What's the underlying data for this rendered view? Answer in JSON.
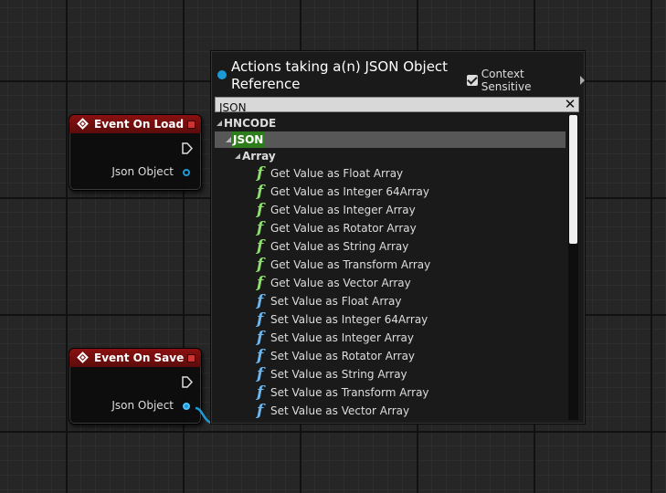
{
  "nodes": {
    "load": {
      "title": "Event On Load",
      "pin_label": "Json Object"
    },
    "save": {
      "title": "Event On Save",
      "pin_label": "Json Object"
    }
  },
  "menu": {
    "title": "Actions taking a(n) JSON Object Reference",
    "context_sensitive_label": "Context Sensitive",
    "context_sensitive_checked": true,
    "search_value": "JSON",
    "clear_icon": "close-icon",
    "tree": {
      "root_category": "HNCODE",
      "selected_category": "JSON",
      "subcategory": "Array",
      "items": [
        {
          "kind": "get",
          "label": "Get Value as Float Array"
        },
        {
          "kind": "get",
          "label": "Get Value as Integer 64Array"
        },
        {
          "kind": "get",
          "label": "Get Value as Integer Array"
        },
        {
          "kind": "get",
          "label": "Get Value as Rotator Array"
        },
        {
          "kind": "get",
          "label": "Get Value as String Array"
        },
        {
          "kind": "get",
          "label": "Get Value as Transform Array"
        },
        {
          "kind": "get",
          "label": "Get Value as Vector Array"
        },
        {
          "kind": "set",
          "label": "Set Value as Float Array"
        },
        {
          "kind": "set",
          "label": "Set Value as Integer 64Array"
        },
        {
          "kind": "set",
          "label": "Set Value as Integer Array"
        },
        {
          "kind": "set",
          "label": "Set Value as Rotator Array"
        },
        {
          "kind": "set",
          "label": "Set Value as String Array"
        },
        {
          "kind": "set",
          "label": "Set Value as Transform Array"
        },
        {
          "kind": "set",
          "label": "Set Value as Vector Array"
        }
      ]
    }
  },
  "colors": {
    "event_header": "#8a1010",
    "object_pin": "#1c9ad6",
    "get_function": "#8fe06e",
    "set_function": "#6cb8ee",
    "search_highlight": "#2e7d1c",
    "selected_row": "#575757"
  }
}
